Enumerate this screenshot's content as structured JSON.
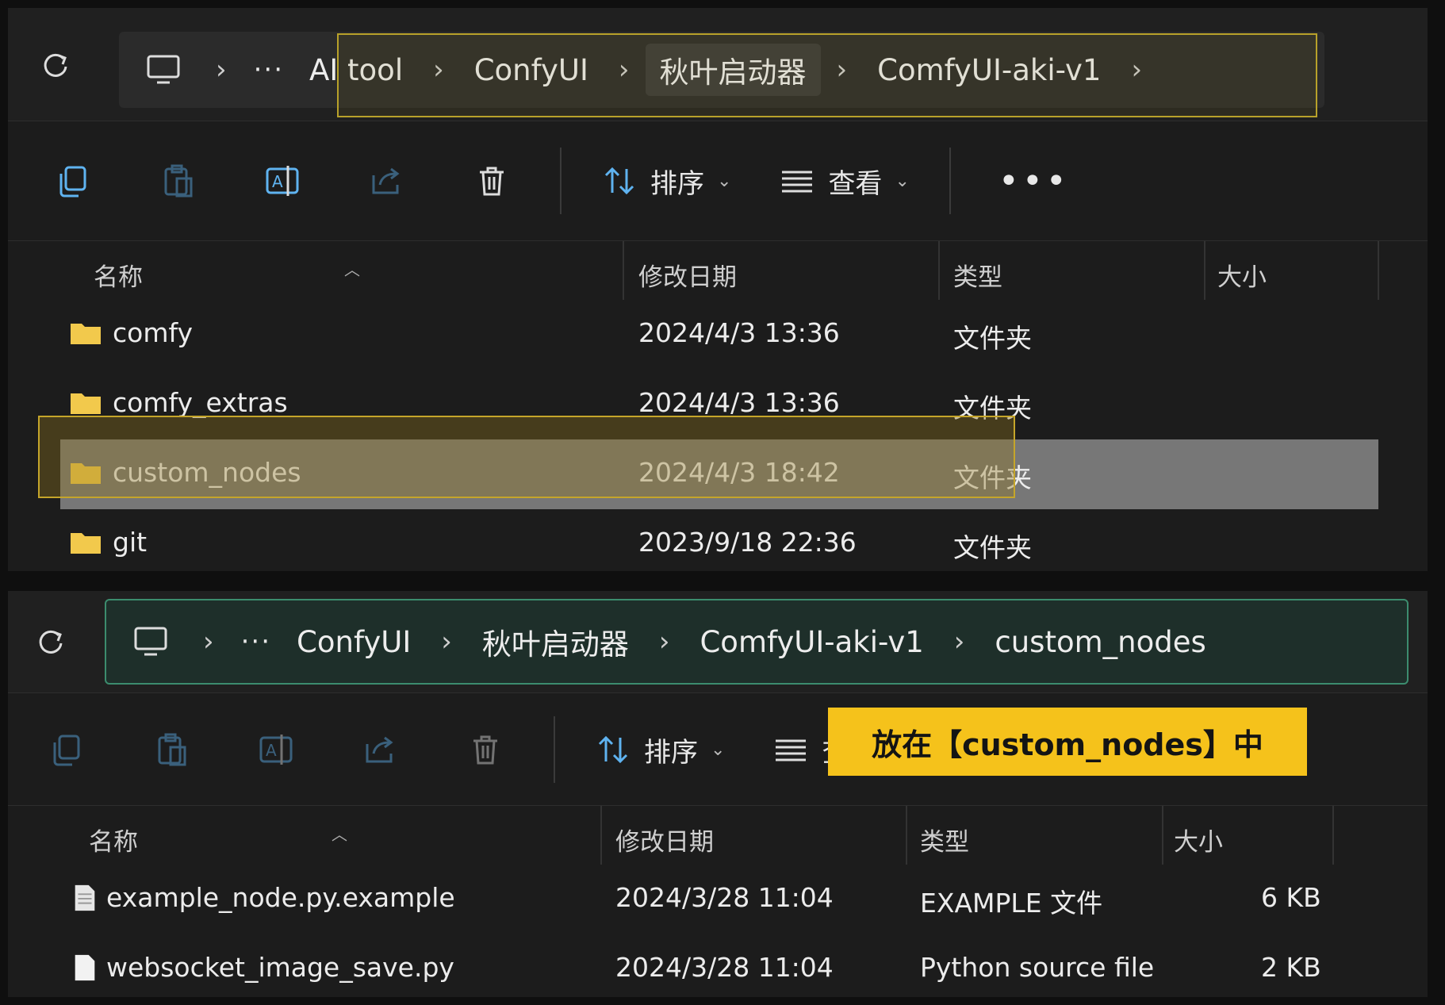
{
  "window1": {
    "breadcrumb": [
      "AI tool",
      "ConfyUI",
      "秋叶启动器",
      "ComfyUI-aki-v1"
    ],
    "toolbar": {
      "sort_label": "排序",
      "view_label": "查看",
      "more_label": "•••"
    },
    "columns": {
      "name": "名称",
      "modified": "修改日期",
      "type": "类型",
      "size": "大小"
    },
    "rows": [
      {
        "name": "comfy",
        "modified": "2024/4/3 13:36",
        "type": "文件夹",
        "size": ""
      },
      {
        "name": "comfy_extras",
        "modified": "2024/4/3 13:36",
        "type": "文件夹",
        "size": ""
      },
      {
        "name": "custom_nodes",
        "modified": "2024/4/3 18:42",
        "type": "文件夹",
        "size": ""
      },
      {
        "name": "git",
        "modified": "2023/9/18 22:36",
        "type": "文件夹",
        "size": ""
      }
    ],
    "selected_row": "custom_nodes"
  },
  "window2": {
    "breadcrumb": [
      "ConfyUI",
      "秋叶启动器",
      "ComfyUI-aki-v1",
      "custom_nodes"
    ],
    "toolbar": {
      "sort_label": "排序",
      "view_label": "查看"
    },
    "columns": {
      "name": "名称",
      "modified": "修改日期",
      "type": "类型",
      "size": "大小"
    },
    "rows": [
      {
        "name": "example_node.py.example",
        "modified": "2024/3/28 11:04",
        "type": "EXAMPLE 文件",
        "size": "6 KB"
      },
      {
        "name": "websocket_image_save.py",
        "modified": "2024/3/28 11:04",
        "type": "Python source file",
        "size": "2 KB"
      }
    ]
  },
  "callout": {
    "text": "放在【custom_nodes】中"
  },
  "colors": {
    "highlight_yellow": "#c5a52a",
    "callout_bg": "#f5c21b",
    "green_border": "#3c8c6e",
    "folder": "#f2c94c"
  },
  "icons": [
    "refresh-icon",
    "computer-icon",
    "copy-icon",
    "paste-icon",
    "rename-icon",
    "share-icon",
    "delete-icon",
    "sort-icon",
    "view-icon",
    "folder-icon",
    "file-icon"
  ]
}
